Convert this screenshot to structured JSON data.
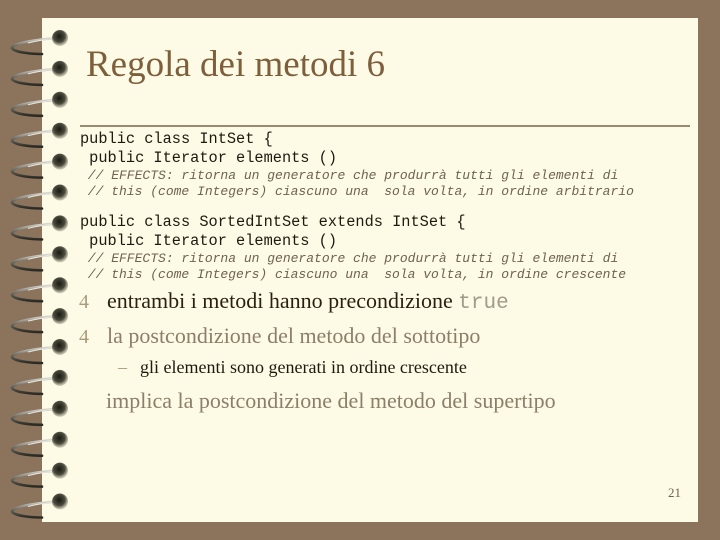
{
  "slide": {
    "title": "Regola dei metodi 6",
    "code_block_1": {
      "line1": "public class IntSet {",
      "line2": " public Iterator elements ()",
      "comment1": " // EFFECTS: ritorna un generatore che produrrà tutti gli elementi di",
      "comment2": " // this (come Integers) ciascuno una  sola volta, in ordine arbitrario"
    },
    "code_block_2": {
      "line1": "public class SortedIntSet extends IntSet {",
      "line2": " public Iterator elements ()",
      "comment1": " // EFFECTS: ritorna un generatore che produrrà tutti gli elementi di",
      "comment2": " // this (come Integers) ciascuno una  sola volta, in ordine crescente"
    },
    "bullets": [
      {
        "marker": "4",
        "text": "entrambi i metodi hanno precondizione ",
        "code": "true"
      },
      {
        "marker": "4",
        "text": "la postcondizione del metodo del sottotipo"
      }
    ],
    "sub_bullet": {
      "marker": "–",
      "text": "gli elementi sono generati in ordine crescente"
    },
    "continuation": "implica la postcondizione del metodo del supertipo",
    "page_number": "21"
  },
  "colors": {
    "background": "#8b735c",
    "page": "#fdfbe6",
    "title": "#7e5f3c",
    "muted_text": "#8c7e68"
  },
  "binding": {
    "ring_count": 16,
    "icon": "spiral-ring-icon"
  }
}
